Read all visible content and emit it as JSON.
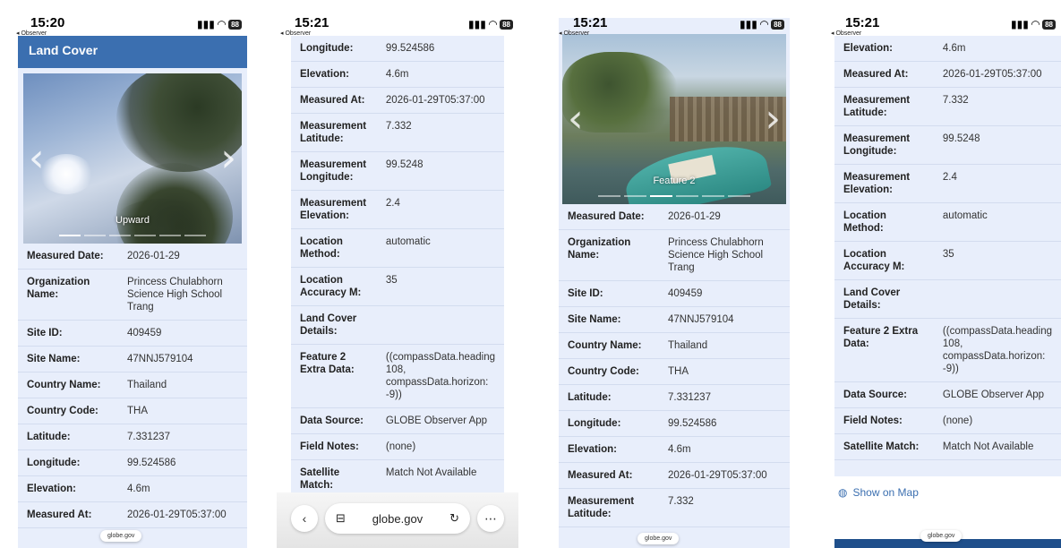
{
  "status_time_1": "15:20",
  "status_time_2": "15:21",
  "back_label": "◂ Observer",
  "battery": "88",
  "header_title": "Land Cover",
  "photo1_caption": "Upward",
  "photo3_caption": "Feature 2",
  "url_short": "globe.gov",
  "url_full": "globe.gov",
  "show_on_map": "Show on Map",
  "phone1_rows": [
    {
      "k": "Measured Date:",
      "v": "2026-01-29"
    },
    {
      "k": "Organization Name:",
      "v": "Princess Chulabhorn Science High School Trang"
    },
    {
      "k": "Site ID:",
      "v": "409459"
    },
    {
      "k": "Site Name:",
      "v": "47NNJ579104"
    },
    {
      "k": "Country Name:",
      "v": "Thailand"
    },
    {
      "k": "Country Code:",
      "v": "THA"
    },
    {
      "k": "Latitude:",
      "v": "7.331237"
    },
    {
      "k": "Longitude:",
      "v": "99.524586"
    },
    {
      "k": "Elevation:",
      "v": "4.6m"
    },
    {
      "k": "Measured At:",
      "v": "2026-01-29T05:37:00"
    }
  ],
  "phone2_rows": [
    {
      "k": "Longitude:",
      "v": "99.524586"
    },
    {
      "k": "Elevation:",
      "v": "4.6m"
    },
    {
      "k": "Measured At:",
      "v": "2026-01-29T05:37:00"
    },
    {
      "k": "Measurement Latitude:",
      "v": "7.332"
    },
    {
      "k": "Measurement Longitude:",
      "v": "99.5248"
    },
    {
      "k": "Measurement Elevation:",
      "v": "2.4"
    },
    {
      "k": "Location Method:",
      "v": "automatic"
    },
    {
      "k": "Location Accuracy M:",
      "v": "35"
    },
    {
      "k": "Land Cover Details:",
      "v": ""
    },
    {
      "k": "Feature 2 Extra Data:",
      "v": "((compassData.heading 108, compassData.horizon: -9))"
    },
    {
      "k": "Data Source:",
      "v": "GLOBE Observer App"
    },
    {
      "k": "Field Notes:",
      "v": "(none)"
    },
    {
      "k": "Satellite Match:",
      "v": "Match Not Available"
    }
  ],
  "phone3_rows": [
    {
      "k": "Measured Date:",
      "v": "2026-01-29"
    },
    {
      "k": "Organization Name:",
      "v": "Princess Chulabhorn Science High School Trang"
    },
    {
      "k": "Site ID:",
      "v": "409459"
    },
    {
      "k": "Site Name:",
      "v": "47NNJ579104"
    },
    {
      "k": "Country Name:",
      "v": "Thailand"
    },
    {
      "k": "Country Code:",
      "v": "THA"
    },
    {
      "k": "Latitude:",
      "v": "7.331237"
    },
    {
      "k": "Longitude:",
      "v": "99.524586"
    },
    {
      "k": "Elevation:",
      "v": "4.6m"
    },
    {
      "k": "Measured At:",
      "v": "2026-01-29T05:37:00"
    },
    {
      "k": "Measurement Latitude:",
      "v": "7.332"
    }
  ],
  "phone4_rows": [
    {
      "k": "Elevation:",
      "v": "4.6m"
    },
    {
      "k": "Measured At:",
      "v": "2026-01-29T05:37:00"
    },
    {
      "k": "Measurement Latitude:",
      "v": "7.332"
    },
    {
      "k": "Measurement Longitude:",
      "v": "99.5248"
    },
    {
      "k": "Measurement Elevation:",
      "v": "2.4"
    },
    {
      "k": "Location Method:",
      "v": "automatic"
    },
    {
      "k": "Location Accuracy M:",
      "v": "35"
    },
    {
      "k": "Land Cover Details:",
      "v": ""
    },
    {
      "k": "Feature 2 Extra Data:",
      "v": "((compassData.heading 108, compassData.horizon: -9))"
    },
    {
      "k": "Data Source:",
      "v": "GLOBE Observer App"
    },
    {
      "k": "Field Notes:",
      "v": "(none)"
    },
    {
      "k": "Satellite Match:",
      "v": "Match Not Available"
    }
  ]
}
